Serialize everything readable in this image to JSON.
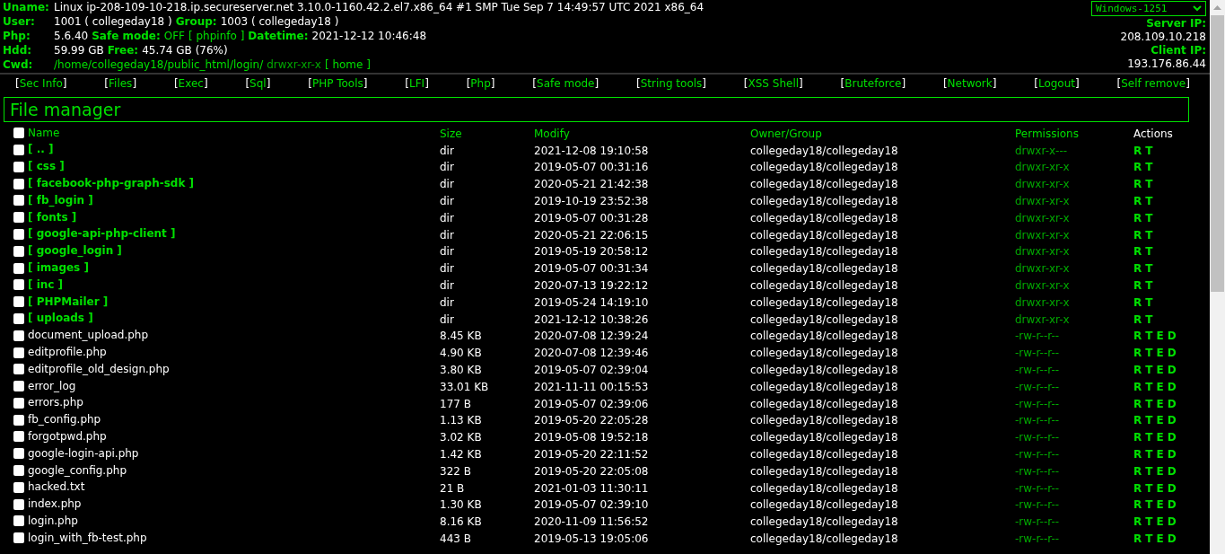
{
  "info_lines": [
    {
      "label": "Uname:",
      "parts": [
        {
          "kind": "value",
          "text": "Linux ip-208-109-10-218.ip.secureserver.net 3.10.0-1160.42.2.el7.x86_64 #1 SMP Tue Sep 7 14:49:57 UTC 2021 x86_64"
        }
      ]
    },
    {
      "label": "User:",
      "parts": [
        {
          "kind": "value",
          "text": "1001 ( collegeday18 )"
        },
        {
          "kind": "label",
          "text": "Group:"
        },
        {
          "kind": "value",
          "text": "1003 ( collegeday18 )"
        }
      ]
    },
    {
      "label": "Php:",
      "parts": [
        {
          "kind": "value",
          "text": "5.6.40"
        },
        {
          "kind": "label",
          "text": "Safe mode:"
        },
        {
          "kind": "status",
          "text": "OFF"
        },
        {
          "kind": "link",
          "text": "[ phpinfo ]"
        },
        {
          "kind": "label",
          "text": "Datetime:"
        },
        {
          "kind": "value",
          "text": "2021-12-12 10:46:48"
        }
      ]
    },
    {
      "label": "Hdd:",
      "parts": [
        {
          "kind": "value",
          "text": "59.99 GB"
        },
        {
          "kind": "label",
          "text": "Free:"
        },
        {
          "kind": "value",
          "text": "45.74 GB (76%)"
        }
      ]
    },
    {
      "label": "Cwd:",
      "parts": [
        {
          "kind": "link",
          "text": "/home/collegeday18/public_html/login/"
        },
        {
          "kind": "perm",
          "text": "drwxr-xr-x"
        },
        {
          "kind": "link",
          "text": "[ home ]"
        }
      ]
    }
  ],
  "charset": "Windows-1251",
  "server_ip": {
    "label": "Server IP:",
    "value": "208.109.10.218"
  },
  "client_ip": {
    "label": "Client IP:",
    "value": "193.176.86.44"
  },
  "nav": [
    {
      "open": "[",
      "label": "Sec Info",
      "close": "]"
    },
    {
      "open": "[",
      "label": "Files",
      "close": "]"
    },
    {
      "open": "[",
      "label": "Exec",
      "close": "]"
    },
    {
      "open": "[",
      "label": "Sql",
      "close": "]"
    },
    {
      "open": "[",
      "label": "PHP Tools",
      "close": "]"
    },
    {
      "open": "[",
      "label": "LFI",
      "close": "]"
    },
    {
      "open": "[",
      "label": "Php",
      "close": "]"
    },
    {
      "open": "[",
      "label": "Safe mode",
      "close": "]"
    },
    {
      "open": "[",
      "label": "String tools",
      "close": "]"
    },
    {
      "open": "[",
      "label": "XSS Shell",
      "close": "]"
    },
    {
      "open": "[",
      "label": "Bruteforce",
      "close": "]"
    },
    {
      "open": "[",
      "label": "Network",
      "close": "]"
    },
    {
      "open": "[",
      "label": "Logout",
      "close": "]"
    },
    {
      "open": "[",
      "label": "Self remove",
      "close": "]"
    }
  ],
  "section_title": "File manager",
  "columns": [
    "Name",
    "Size",
    "Modify",
    "Owner/Group",
    "Permissions",
    "Actions"
  ],
  "select_all_checked": false,
  "rows": [
    {
      "kind": "dir",
      "name": "[ .. ]",
      "size": "dir",
      "modify": "2021-12-08 19:10:58",
      "owner": "collegeday18/collegeday18",
      "perms": "drwxr-x---",
      "actions": [
        "R",
        "T"
      ],
      "checked": false
    },
    {
      "kind": "dir",
      "name": "[ css ]",
      "size": "dir",
      "modify": "2019-05-07 00:31:16",
      "owner": "collegeday18/collegeday18",
      "perms": "drwxr-xr-x",
      "actions": [
        "R",
        "T"
      ],
      "checked": false
    },
    {
      "kind": "dir",
      "name": "[ facebook-php-graph-sdk ]",
      "size": "dir",
      "modify": "2020-05-21 21:42:38",
      "owner": "collegeday18/collegeday18",
      "perms": "drwxr-xr-x",
      "actions": [
        "R",
        "T"
      ],
      "checked": false
    },
    {
      "kind": "dir",
      "name": "[ fb_login ]",
      "size": "dir",
      "modify": "2019-10-19 23:52:38",
      "owner": "collegeday18/collegeday18",
      "perms": "drwxr-xr-x",
      "actions": [
        "R",
        "T"
      ],
      "checked": false
    },
    {
      "kind": "dir",
      "name": "[ fonts ]",
      "size": "dir",
      "modify": "2019-05-07 00:31:28",
      "owner": "collegeday18/collegeday18",
      "perms": "drwxr-xr-x",
      "actions": [
        "R",
        "T"
      ],
      "checked": false
    },
    {
      "kind": "dir",
      "name": "[ google-api-php-client ]",
      "size": "dir",
      "modify": "2020-05-21 22:06:15",
      "owner": "collegeday18/collegeday18",
      "perms": "drwxr-xr-x",
      "actions": [
        "R",
        "T"
      ],
      "checked": false
    },
    {
      "kind": "dir",
      "name": "[ google_login ]",
      "size": "dir",
      "modify": "2019-05-19 20:58:12",
      "owner": "collegeday18/collegeday18",
      "perms": "drwxr-xr-x",
      "actions": [
        "R",
        "T"
      ],
      "checked": false
    },
    {
      "kind": "dir",
      "name": "[ images ]",
      "size": "dir",
      "modify": "2019-05-07 00:31:34",
      "owner": "collegeday18/collegeday18",
      "perms": "drwxr-xr-x",
      "actions": [
        "R",
        "T"
      ],
      "checked": false
    },
    {
      "kind": "dir",
      "name": "[ inc ]",
      "size": "dir",
      "modify": "2020-07-13 19:22:12",
      "owner": "collegeday18/collegeday18",
      "perms": "drwxr-xr-x",
      "actions": [
        "R",
        "T"
      ],
      "checked": false
    },
    {
      "kind": "dir",
      "name": "[ PHPMailer ]",
      "size": "dir",
      "modify": "2019-05-24 14:19:10",
      "owner": "collegeday18/collegeday18",
      "perms": "drwxr-xr-x",
      "actions": [
        "R",
        "T"
      ],
      "checked": false
    },
    {
      "kind": "dir",
      "name": "[ uploads ]",
      "size": "dir",
      "modify": "2021-12-12 10:38:26",
      "owner": "collegeday18/collegeday18",
      "perms": "drwxr-xr-x",
      "actions": [
        "R",
        "T"
      ],
      "checked": false
    },
    {
      "kind": "file",
      "name": "document_upload.php",
      "size": "8.45 KB",
      "modify": "2020-07-08 12:39:24",
      "owner": "collegeday18/collegeday18",
      "perms": "-rw-r--r--",
      "actions": [
        "R",
        "T",
        "E",
        "D"
      ],
      "checked": false
    },
    {
      "kind": "file",
      "name": "editprofile.php",
      "size": "4.90 KB",
      "modify": "2020-07-08 12:39:46",
      "owner": "collegeday18/collegeday18",
      "perms": "-rw-r--r--",
      "actions": [
        "R",
        "T",
        "E",
        "D"
      ],
      "checked": false
    },
    {
      "kind": "file",
      "name": "editprofile_old_design.php",
      "size": "3.80 KB",
      "modify": "2019-05-07 02:39:04",
      "owner": "collegeday18/collegeday18",
      "perms": "-rw-r--r--",
      "actions": [
        "R",
        "T",
        "E",
        "D"
      ],
      "checked": false
    },
    {
      "kind": "file",
      "name": "error_log",
      "size": "33.01 KB",
      "modify": "2021-11-11 00:15:53",
      "owner": "collegeday18/collegeday18",
      "perms": "-rw-r--r--",
      "actions": [
        "R",
        "T",
        "E",
        "D"
      ],
      "checked": false
    },
    {
      "kind": "file",
      "name": "errors.php",
      "size": "177 B",
      "modify": "2019-05-07 02:39:06",
      "owner": "collegeday18/collegeday18",
      "perms": "-rw-r--r--",
      "actions": [
        "R",
        "T",
        "E",
        "D"
      ],
      "checked": false
    },
    {
      "kind": "file",
      "name": "fb_config.php",
      "size": "1.13 KB",
      "modify": "2019-05-20 22:05:28",
      "owner": "collegeday18/collegeday18",
      "perms": "-rw-r--r--",
      "actions": [
        "R",
        "T",
        "E",
        "D"
      ],
      "checked": false
    },
    {
      "kind": "file",
      "name": "forgotpwd.php",
      "size": "3.02 KB",
      "modify": "2019-05-08 19:52:18",
      "owner": "collegeday18/collegeday18",
      "perms": "-rw-r--r--",
      "actions": [
        "R",
        "T",
        "E",
        "D"
      ],
      "checked": false
    },
    {
      "kind": "file",
      "name": "google-login-api.php",
      "size": "1.42 KB",
      "modify": "2019-05-20 22:11:52",
      "owner": "collegeday18/collegeday18",
      "perms": "-rw-r--r--",
      "actions": [
        "R",
        "T",
        "E",
        "D"
      ],
      "checked": false
    },
    {
      "kind": "file",
      "name": "google_config.php",
      "size": "322 B",
      "modify": "2019-05-20 22:05:08",
      "owner": "collegeday18/collegeday18",
      "perms": "-rw-r--r--",
      "actions": [
        "R",
        "T",
        "E",
        "D"
      ],
      "checked": false
    },
    {
      "kind": "file",
      "name": "hacked.txt",
      "size": "21 B",
      "modify": "2021-01-03 11:30:11",
      "owner": "collegeday18/collegeday18",
      "perms": "-rw-r--r--",
      "actions": [
        "R",
        "T",
        "E",
        "D"
      ],
      "checked": false
    },
    {
      "kind": "file",
      "name": "index.php",
      "size": "1.30 KB",
      "modify": "2019-05-07 02:39:10",
      "owner": "collegeday18/collegeday18",
      "perms": "-rw-r--r--",
      "actions": [
        "R",
        "T",
        "E",
        "D"
      ],
      "checked": false
    },
    {
      "kind": "file",
      "name": "login.php",
      "size": "8.16 KB",
      "modify": "2020-11-09 11:56:52",
      "owner": "collegeday18/collegeday18",
      "perms": "-rw-r--r--",
      "actions": [
        "R",
        "T",
        "E",
        "D"
      ],
      "checked": false
    },
    {
      "kind": "file",
      "name": "login_with_fb-test.php",
      "size": "443 B",
      "modify": "2019-05-13 19:05:06",
      "owner": "collegeday18/collegeday18",
      "perms": "-rw-r--r--",
      "actions": [
        "R",
        "T",
        "E",
        "D"
      ],
      "checked": false
    }
  ]
}
